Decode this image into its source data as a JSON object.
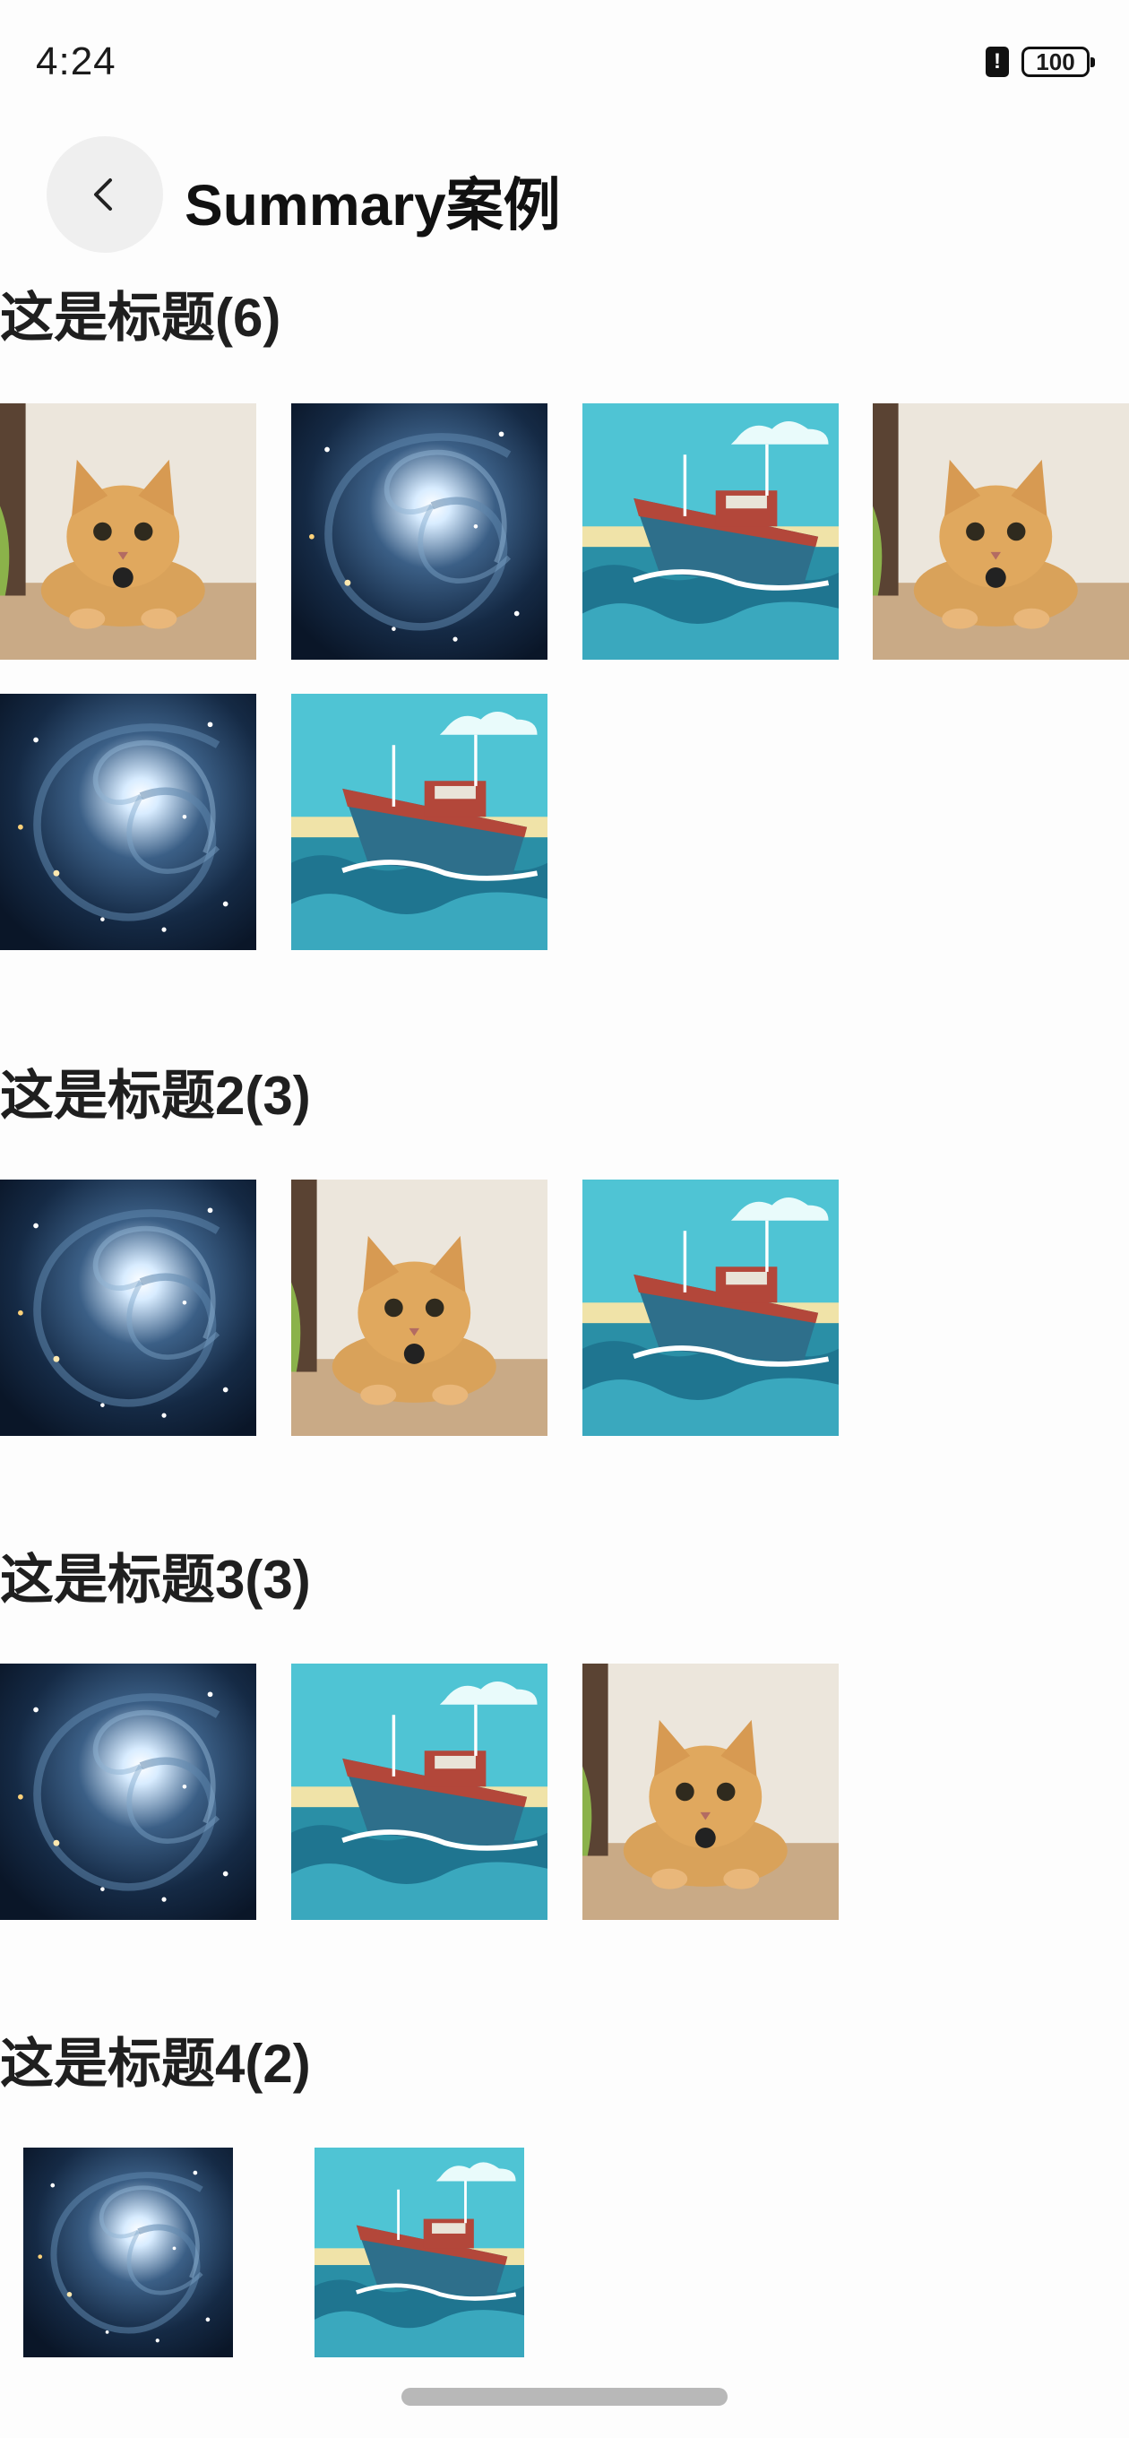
{
  "status_bar": {
    "time": "4:24",
    "alert_glyph": "!",
    "battery": "100"
  },
  "header": {
    "back_icon": "chevron-left-icon",
    "title": "Summary案例"
  },
  "sections": [
    {
      "title": "这是标题(6)",
      "images": [
        "cat",
        "galaxy",
        "boat",
        "cat",
        "galaxy",
        "boat"
      ]
    },
    {
      "title": "这是标题2(3)",
      "images": [
        "galaxy",
        "cat",
        "boat"
      ]
    },
    {
      "title": "这是标题3(3)",
      "images": [
        "galaxy",
        "boat",
        "cat"
      ]
    },
    {
      "title": "这是标题4(2)",
      "images": [
        "galaxy",
        "boat"
      ]
    }
  ],
  "colors": {
    "background": "#fdfdfd",
    "back_button_bg": "#efefef",
    "home_indicator": "#b8b8b8"
  }
}
